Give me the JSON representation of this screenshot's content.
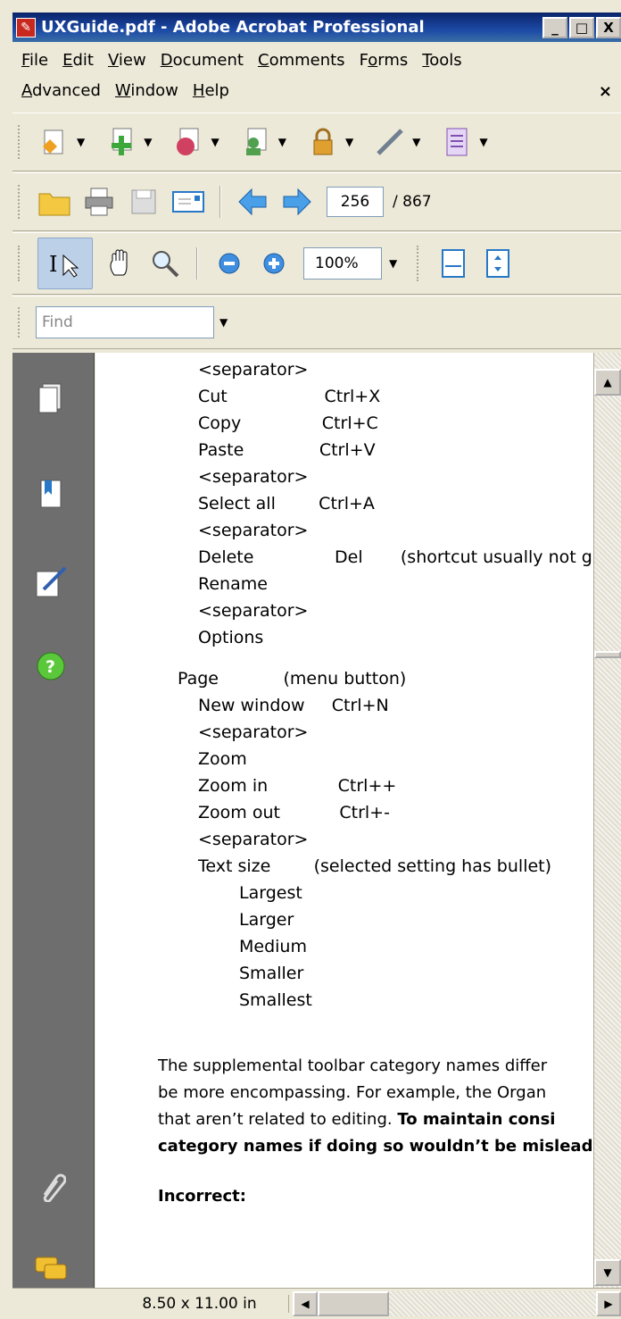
{
  "window": {
    "title": "UXGuide.pdf - Adobe Acrobat Professional",
    "app_icon": "pdf-icon",
    "buttons": {
      "minimize": "_",
      "maximize": "□",
      "close": "X"
    }
  },
  "menubar": {
    "row1": [
      {
        "label": "File",
        "accel": "F",
        "rest": "ile"
      },
      {
        "label": "Edit",
        "accel": "E",
        "rest": "dit"
      },
      {
        "label": "View",
        "accel": "V",
        "rest": "iew"
      },
      {
        "label": "Document",
        "accel": "D",
        "rest": "ocument"
      },
      {
        "label": "Comments",
        "accel": "C",
        "rest": "omments"
      },
      {
        "label": "Forms",
        "pre": "F",
        "accel": "o",
        "rest": "rms"
      },
      {
        "label": "Tools",
        "accel": "T",
        "rest": "ools"
      }
    ],
    "row2": [
      {
        "label": "Advanced",
        "accel": "A",
        "rest": "dvanced"
      },
      {
        "label": "Window",
        "accel": "W",
        "rest": "indow"
      },
      {
        "label": "Help",
        "accel": "H",
        "rest": "elp"
      }
    ],
    "close_doc": "×"
  },
  "toolbar_nav": {
    "page_current": "256",
    "page_total": "/ 867"
  },
  "toolbar_zoom": {
    "zoom_value": "100%"
  },
  "find": {
    "placeholder": "Find"
  },
  "document": {
    "lines": [
      {
        "text": "<separator>",
        "indent": 1
      },
      {
        "text": "Cut                  Ctrl+X",
        "indent": 1
      },
      {
        "text": "Copy               Ctrl+C",
        "indent": 1
      },
      {
        "text": "Paste              Ctrl+V",
        "indent": 1
      },
      {
        "text": "<separator>",
        "indent": 1
      },
      {
        "text": "Select all        Ctrl+A",
        "indent": 1
      },
      {
        "text": "<separator>",
        "indent": 1
      },
      {
        "text": "Delete               Del       (shortcut usually not g",
        "indent": 1
      },
      {
        "text": "Rename",
        "indent": 1
      },
      {
        "text": "<separator>",
        "indent": 1
      },
      {
        "text": "Options",
        "indent": 1
      },
      {
        "text": "Page            (menu button)",
        "indent": 0
      },
      {
        "text": "New window     Ctrl+N",
        "indent": 1
      },
      {
        "text": "<separator>",
        "indent": 1
      },
      {
        "text": "Zoom",
        "indent": 1
      },
      {
        "text": "Zoom in             Ctrl++",
        "indent": 1
      },
      {
        "text": "Zoom out           Ctrl+-",
        "indent": 1
      },
      {
        "text": "<separator>",
        "indent": 1
      },
      {
        "text": "Text size        (selected setting has bullet)",
        "indent": 1
      },
      {
        "text": "Largest",
        "indent": 2
      },
      {
        "text": "Larger",
        "indent": 2
      },
      {
        "text": "Medium",
        "indent": 2
      },
      {
        "text": "Smaller",
        "indent": 2
      },
      {
        "text": "Smallest",
        "indent": 2
      }
    ],
    "paragraph": [
      "The supplemental toolbar category names differ",
      "be more encompassing. For example, the Organ",
      "that aren’t related to editing. ",
      "category names if doing so wouldn’t be mislead"
    ],
    "paragraph_bold_tail": "To maintain consi",
    "incorrect_label": "Incorrect:"
  },
  "statusbar": {
    "page_size": "8.50 x 11.00 in"
  }
}
